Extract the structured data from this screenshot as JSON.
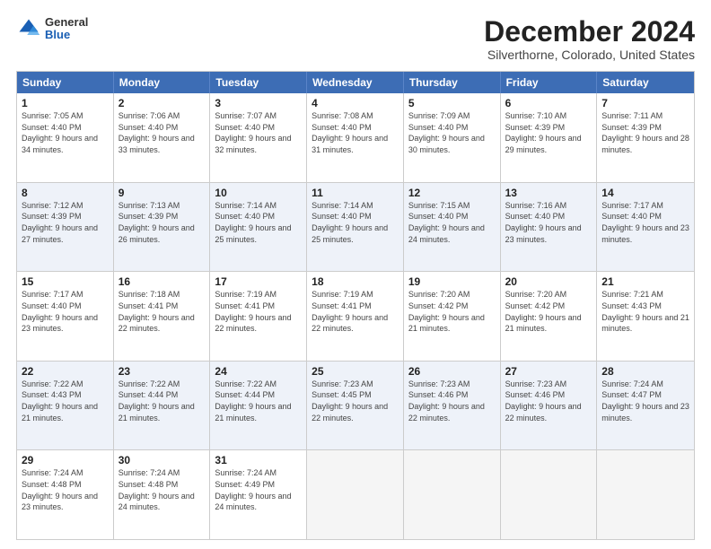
{
  "header": {
    "logo": {
      "general": "General",
      "blue": "Blue"
    },
    "title": "December 2024",
    "subtitle": "Silverthorne, Colorado, United States"
  },
  "calendar": {
    "days": [
      "Sunday",
      "Monday",
      "Tuesday",
      "Wednesday",
      "Thursday",
      "Friday",
      "Saturday"
    ],
    "rows": [
      [
        {
          "day": "1",
          "sunrise": "Sunrise: 7:05 AM",
          "sunset": "Sunset: 4:40 PM",
          "daylight": "Daylight: 9 hours and 34 minutes."
        },
        {
          "day": "2",
          "sunrise": "Sunrise: 7:06 AM",
          "sunset": "Sunset: 4:40 PM",
          "daylight": "Daylight: 9 hours and 33 minutes."
        },
        {
          "day": "3",
          "sunrise": "Sunrise: 7:07 AM",
          "sunset": "Sunset: 4:40 PM",
          "daylight": "Daylight: 9 hours and 32 minutes."
        },
        {
          "day": "4",
          "sunrise": "Sunrise: 7:08 AM",
          "sunset": "Sunset: 4:40 PM",
          "daylight": "Daylight: 9 hours and 31 minutes."
        },
        {
          "day": "5",
          "sunrise": "Sunrise: 7:09 AM",
          "sunset": "Sunset: 4:40 PM",
          "daylight": "Daylight: 9 hours and 30 minutes."
        },
        {
          "day": "6",
          "sunrise": "Sunrise: 7:10 AM",
          "sunset": "Sunset: 4:39 PM",
          "daylight": "Daylight: 9 hours and 29 minutes."
        },
        {
          "day": "7",
          "sunrise": "Sunrise: 7:11 AM",
          "sunset": "Sunset: 4:39 PM",
          "daylight": "Daylight: 9 hours and 28 minutes."
        }
      ],
      [
        {
          "day": "8",
          "sunrise": "Sunrise: 7:12 AM",
          "sunset": "Sunset: 4:39 PM",
          "daylight": "Daylight: 9 hours and 27 minutes."
        },
        {
          "day": "9",
          "sunrise": "Sunrise: 7:13 AM",
          "sunset": "Sunset: 4:39 PM",
          "daylight": "Daylight: 9 hours and 26 minutes."
        },
        {
          "day": "10",
          "sunrise": "Sunrise: 7:14 AM",
          "sunset": "Sunset: 4:40 PM",
          "daylight": "Daylight: 9 hours and 25 minutes."
        },
        {
          "day": "11",
          "sunrise": "Sunrise: 7:14 AM",
          "sunset": "Sunset: 4:40 PM",
          "daylight": "Daylight: 9 hours and 25 minutes."
        },
        {
          "day": "12",
          "sunrise": "Sunrise: 7:15 AM",
          "sunset": "Sunset: 4:40 PM",
          "daylight": "Daylight: 9 hours and 24 minutes."
        },
        {
          "day": "13",
          "sunrise": "Sunrise: 7:16 AM",
          "sunset": "Sunset: 4:40 PM",
          "daylight": "Daylight: 9 hours and 23 minutes."
        },
        {
          "day": "14",
          "sunrise": "Sunrise: 7:17 AM",
          "sunset": "Sunset: 4:40 PM",
          "daylight": "Daylight: 9 hours and 23 minutes."
        }
      ],
      [
        {
          "day": "15",
          "sunrise": "Sunrise: 7:17 AM",
          "sunset": "Sunset: 4:40 PM",
          "daylight": "Daylight: 9 hours and 23 minutes."
        },
        {
          "day": "16",
          "sunrise": "Sunrise: 7:18 AM",
          "sunset": "Sunset: 4:41 PM",
          "daylight": "Daylight: 9 hours and 22 minutes."
        },
        {
          "day": "17",
          "sunrise": "Sunrise: 7:19 AM",
          "sunset": "Sunset: 4:41 PM",
          "daylight": "Daylight: 9 hours and 22 minutes."
        },
        {
          "day": "18",
          "sunrise": "Sunrise: 7:19 AM",
          "sunset": "Sunset: 4:41 PM",
          "daylight": "Daylight: 9 hours and 22 minutes."
        },
        {
          "day": "19",
          "sunrise": "Sunrise: 7:20 AM",
          "sunset": "Sunset: 4:42 PM",
          "daylight": "Daylight: 9 hours and 21 minutes."
        },
        {
          "day": "20",
          "sunrise": "Sunrise: 7:20 AM",
          "sunset": "Sunset: 4:42 PM",
          "daylight": "Daylight: 9 hours and 21 minutes."
        },
        {
          "day": "21",
          "sunrise": "Sunrise: 7:21 AM",
          "sunset": "Sunset: 4:43 PM",
          "daylight": "Daylight: 9 hours and 21 minutes."
        }
      ],
      [
        {
          "day": "22",
          "sunrise": "Sunrise: 7:22 AM",
          "sunset": "Sunset: 4:43 PM",
          "daylight": "Daylight: 9 hours and 21 minutes."
        },
        {
          "day": "23",
          "sunrise": "Sunrise: 7:22 AM",
          "sunset": "Sunset: 4:44 PM",
          "daylight": "Daylight: 9 hours and 21 minutes."
        },
        {
          "day": "24",
          "sunrise": "Sunrise: 7:22 AM",
          "sunset": "Sunset: 4:44 PM",
          "daylight": "Daylight: 9 hours and 21 minutes."
        },
        {
          "day": "25",
          "sunrise": "Sunrise: 7:23 AM",
          "sunset": "Sunset: 4:45 PM",
          "daylight": "Daylight: 9 hours and 22 minutes."
        },
        {
          "day": "26",
          "sunrise": "Sunrise: 7:23 AM",
          "sunset": "Sunset: 4:46 PM",
          "daylight": "Daylight: 9 hours and 22 minutes."
        },
        {
          "day": "27",
          "sunrise": "Sunrise: 7:23 AM",
          "sunset": "Sunset: 4:46 PM",
          "daylight": "Daylight: 9 hours and 22 minutes."
        },
        {
          "day": "28",
          "sunrise": "Sunrise: 7:24 AM",
          "sunset": "Sunset: 4:47 PM",
          "daylight": "Daylight: 9 hours and 23 minutes."
        }
      ],
      [
        {
          "day": "29",
          "sunrise": "Sunrise: 7:24 AM",
          "sunset": "Sunset: 4:48 PM",
          "daylight": "Daylight: 9 hours and 23 minutes."
        },
        {
          "day": "30",
          "sunrise": "Sunrise: 7:24 AM",
          "sunset": "Sunset: 4:48 PM",
          "daylight": "Daylight: 9 hours and 24 minutes."
        },
        {
          "day": "31",
          "sunrise": "Sunrise: 7:24 AM",
          "sunset": "Sunset: 4:49 PM",
          "daylight": "Daylight: 9 hours and 24 minutes."
        },
        null,
        null,
        null,
        null
      ]
    ]
  }
}
